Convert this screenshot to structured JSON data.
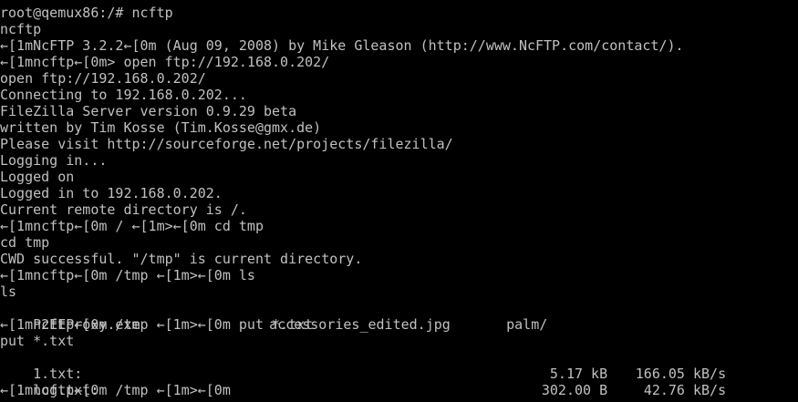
{
  "colors": {
    "background": "#000000",
    "foreground": "#c0c0c0"
  },
  "terminal": {
    "lines": [
      "root@qemux86:/# ncftp",
      "ncftp",
      "←[1mNcFTP 3.2.2←[0m (Aug 09, 2008) by Mike Gleason (http://www.NcFTP.com/contact/).",
      "←[1mncftp←[0m> open ftp://192.168.0.202/",
      "open ftp://192.168.0.202/",
      "Connecting to 192.168.0.202...",
      "FileZilla Server version 0.9.29 beta",
      "written by Tim Kosse (Tim.Kosse@gmx.de)",
      "Please visit http://sourceforge.net/projects/filezilla/",
      "Logging in...",
      "Logged on",
      "Logged in to 192.168.0.202.",
      "Current remote directory is /.",
      "←[1mncftp←[0m / ←[1m>←[0m cd tmp",
      "cd tmp",
      "CWD successful. \"/tmp\" is current directory.",
      "←[1mncftp←[0m /tmp ←[1m>←[0m ls",
      "ls"
    ],
    "ls_output": [
      "P2EEProxy.exe",
      "accessories_edited.jpg",
      "palm/"
    ],
    "put_prompt": "←[1mncftp←[0m /tmp ←[1m>←[0m put *.txt",
    "put_echo": "put *.txt",
    "transfers": [
      {
        "name": "1.txt:",
        "size": "5.17 kB",
        "rate": "166.05 kB/s"
      },
      {
        "name": "log.txt:",
        "size": "302.00 B",
        "rate": "42.76 kB/s"
      }
    ],
    "final_prompt": "←[1mncftp←[0m /tmp ←[1m>←[0m"
  }
}
